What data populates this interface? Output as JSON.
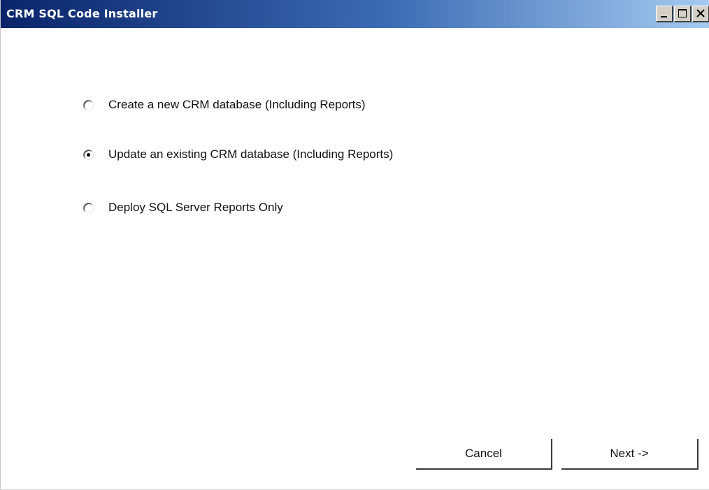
{
  "window": {
    "title": "CRM SQL Code Installer"
  },
  "options": [
    {
      "label": "Create a new CRM database (Including Reports)",
      "selected": false
    },
    {
      "label": "Update an existing CRM database (Including Reports)",
      "selected": true
    },
    {
      "label": "Deploy SQL Server Reports Only",
      "selected": false
    }
  ],
  "buttons": {
    "cancel_label": "Cancel",
    "next_label": "Next ->"
  },
  "colors": {
    "titlebar_start": "#0a246a",
    "titlebar_end": "#a6caf0"
  },
  "icons": {
    "minimize": "minimize-icon",
    "maximize": "maximize-icon",
    "close": "close-icon"
  }
}
